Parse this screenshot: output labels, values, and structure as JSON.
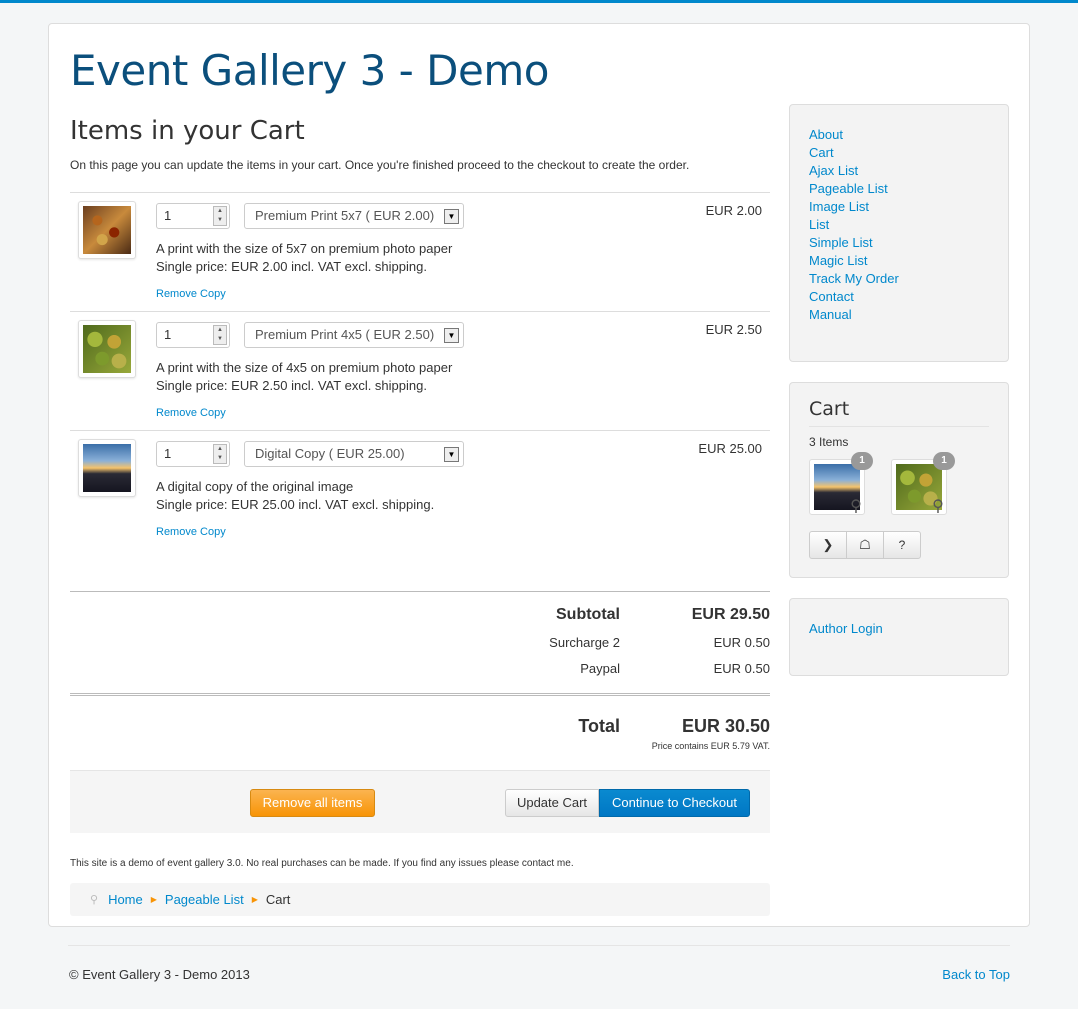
{
  "site": {
    "title": "Event Gallery 3 - Demo"
  },
  "page": {
    "heading": "Items in your Cart",
    "intro": "On this page you can update the items in your cart. Once you're finished proceed to the checkout to create the order."
  },
  "cart": {
    "items": [
      {
        "qty": "1",
        "option": "Premium Print 5x7 ( EUR 2.00)",
        "price": "EUR 2.00",
        "desc1": "A print with the size of 5x7 on premium photo paper",
        "desc2": "Single price: EUR 2.00 incl. VAT excl. shipping.",
        "remove": "Remove Copy"
      },
      {
        "qty": "1",
        "option": "Premium Print 4x5 ( EUR 2.50)",
        "price": "EUR 2.50",
        "desc1": "A print with the size of 4x5 on premium photo paper",
        "desc2": "Single price: EUR 2.50 incl. VAT excl. shipping.",
        "remove": "Remove Copy"
      },
      {
        "qty": "1",
        "option": "Digital Copy ( EUR 25.00)",
        "price": "EUR 25.00",
        "desc1": "A digital copy of the original image",
        "desc2": "Single price: EUR 25.00 incl. VAT excl. shipping.",
        "remove": "Remove Copy"
      }
    ],
    "totals": {
      "subtotal_label": "Subtotal",
      "subtotal": "EUR 29.50",
      "surcharge_label": "Surcharge 2",
      "surcharge": "EUR 0.50",
      "paypal_label": "Paypal",
      "paypal": "EUR 0.50",
      "total_label": "Total",
      "total": "EUR 30.50",
      "vat_note": "Price contains EUR 5.79 VAT."
    },
    "buttons": {
      "remove_all": "Remove all items",
      "update": "Update Cart",
      "checkout": "Continue to Checkout"
    }
  },
  "disclaimer": "This site is a demo of event gallery 3.0. No real purchases can be made. If you find any issues please contact me.",
  "breadcrumb": {
    "home": "Home",
    "pageable": "Pageable List",
    "current": "Cart"
  },
  "sidebar": {
    "menu": [
      "About",
      "Cart",
      "Ajax List",
      "Pageable List",
      "Image List",
      "List",
      "Simple List",
      "Magic List",
      "Track My Order",
      "Contact",
      "Manual"
    ],
    "cart_module": {
      "title": "Cart",
      "count": "3 Items",
      "badge1": "1",
      "badge2": "1",
      "help": "?"
    },
    "author_login": "Author Login"
  },
  "footer": {
    "copyright": "© Event Gallery 3 - Demo 2013",
    "back_to_top": "Back to Top"
  },
  "icons": {
    "spinner": "spinner-arrows-icon",
    "select_arrow": "dropdown-arrow-icon",
    "pin": "map-marker-icon",
    "divider": "triangle-right-icon",
    "basket": "basket-icon",
    "chevron": "chevron-down-icon"
  },
  "colors": {
    "accent": "#0088cc",
    "title": "#0b4f7c",
    "orange": "#f89406"
  }
}
